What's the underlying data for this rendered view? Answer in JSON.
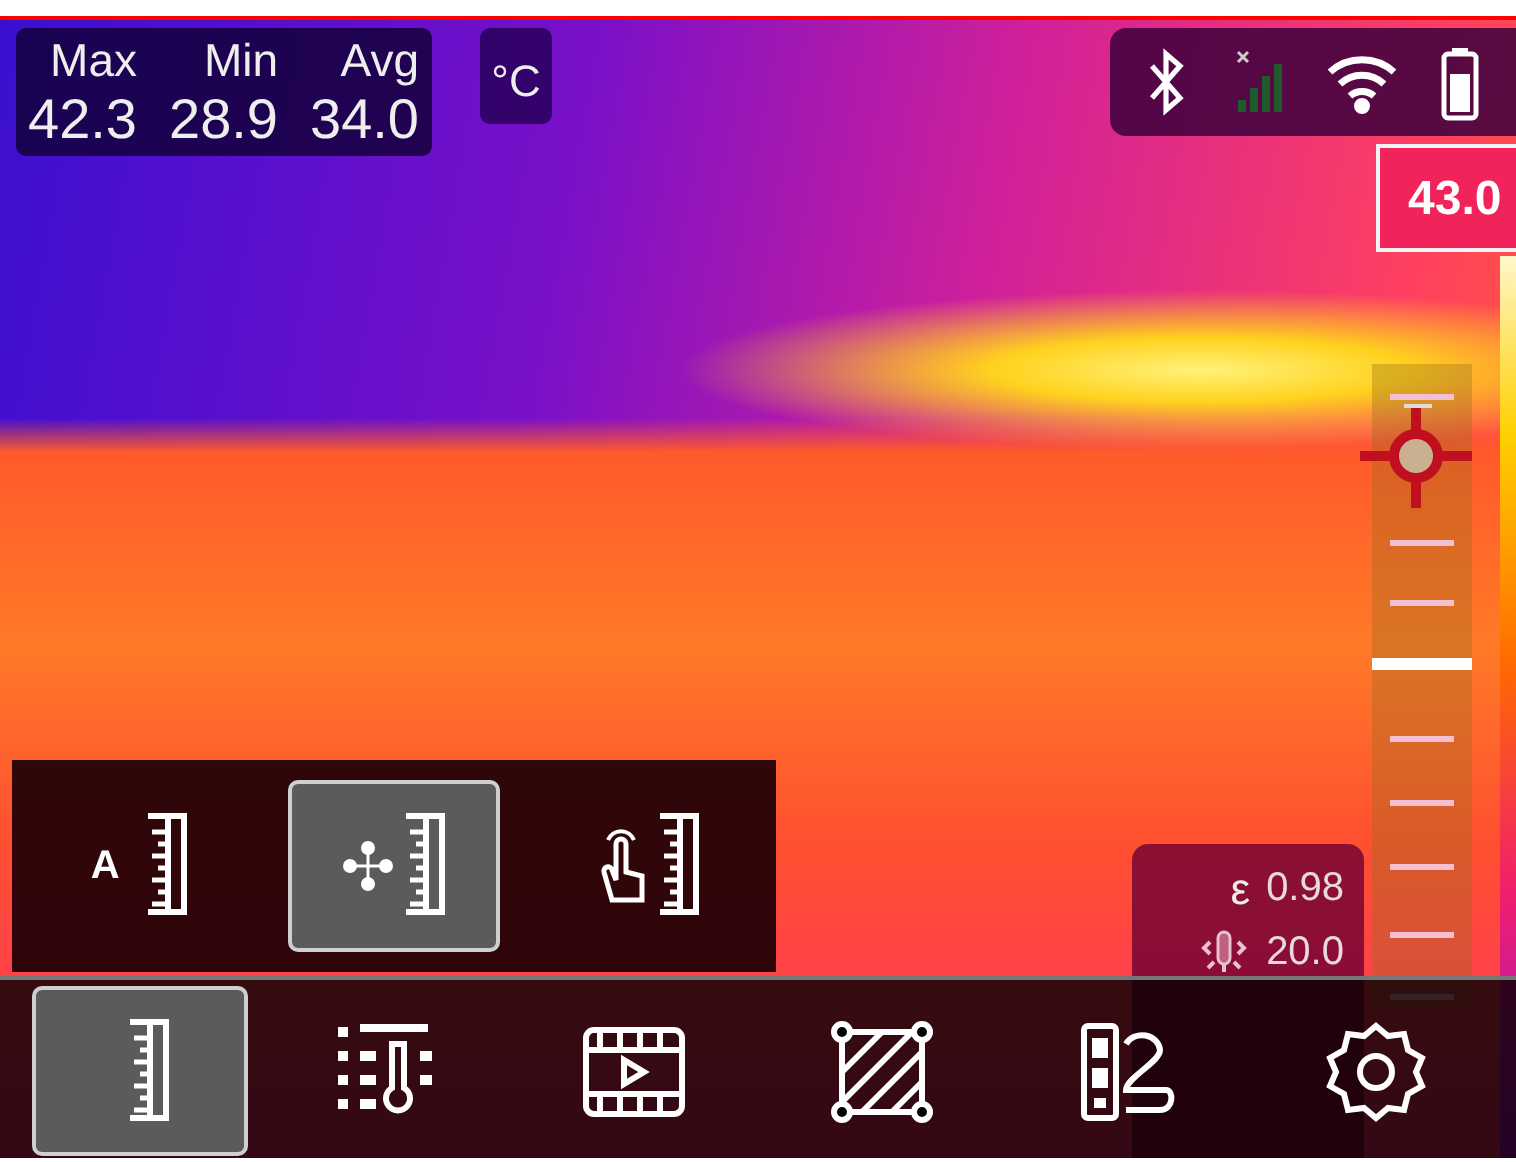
{
  "stats": [
    {
      "label": "Max",
      "value": "42.3"
    },
    {
      "label": "Min",
      "value": "28.9"
    },
    {
      "label": "Avg",
      "value": "34.0"
    }
  ],
  "unit": "°C",
  "scale": {
    "max": "43.0",
    "level": 0.51
  },
  "scale_modes": [
    {
      "kind": "auto",
      "badge": "A",
      "selected": false
    },
    {
      "kind": "pan",
      "selected": true
    },
    {
      "kind": "touch",
      "selected": false
    }
  ],
  "params": [
    {
      "kind": "emissivity",
      "symbol": "ε",
      "value": "0.98"
    },
    {
      "kind": "reflected",
      "value": "20.0"
    }
  ],
  "toolbar": [
    {
      "kind": "scale",
      "selected": true
    },
    {
      "kind": "palette",
      "selected": false
    },
    {
      "kind": "video",
      "selected": false
    },
    {
      "kind": "area",
      "selected": false
    },
    {
      "kind": "compare",
      "selected": false
    },
    {
      "kind": "settings",
      "selected": false
    }
  ]
}
